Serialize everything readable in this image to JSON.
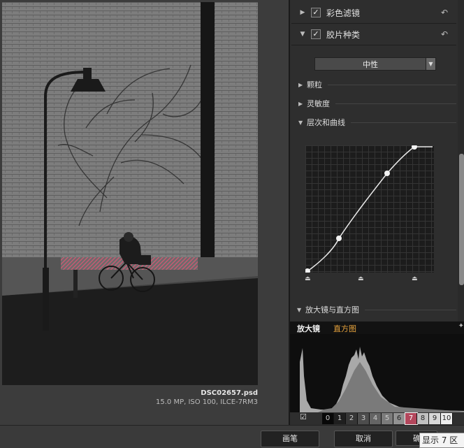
{
  "image": {
    "filename": "DSC02657.psd",
    "meta": "15.0 MP, ISO 100, ILCE-7RM3"
  },
  "panel": {
    "color_filter": {
      "label": "彩色滤镜",
      "checked": true
    },
    "film_type": {
      "label": "胶片种类",
      "checked": true
    },
    "film_preset": "中性",
    "grain": "颗粒",
    "sensitivity": "灵敏度",
    "levels_curves": "层次和曲线",
    "loupe_section": "放大镜与直方图"
  },
  "hist": {
    "tab_loupe": "放大镜",
    "tab_hist": "直方图",
    "zones": [
      "0",
      "1",
      "2",
      "3",
      "4",
      "5",
      "6",
      "7",
      "8",
      "9",
      "10"
    ],
    "selected_zone": "7"
  },
  "buttons": {
    "brush": "画笔",
    "cancel": "取消",
    "ok": "确"
  },
  "tooltip": "显示 7 区",
  "colors": {
    "accent_orange": "#e6a23c",
    "zone_highlight": "#b3475c"
  }
}
